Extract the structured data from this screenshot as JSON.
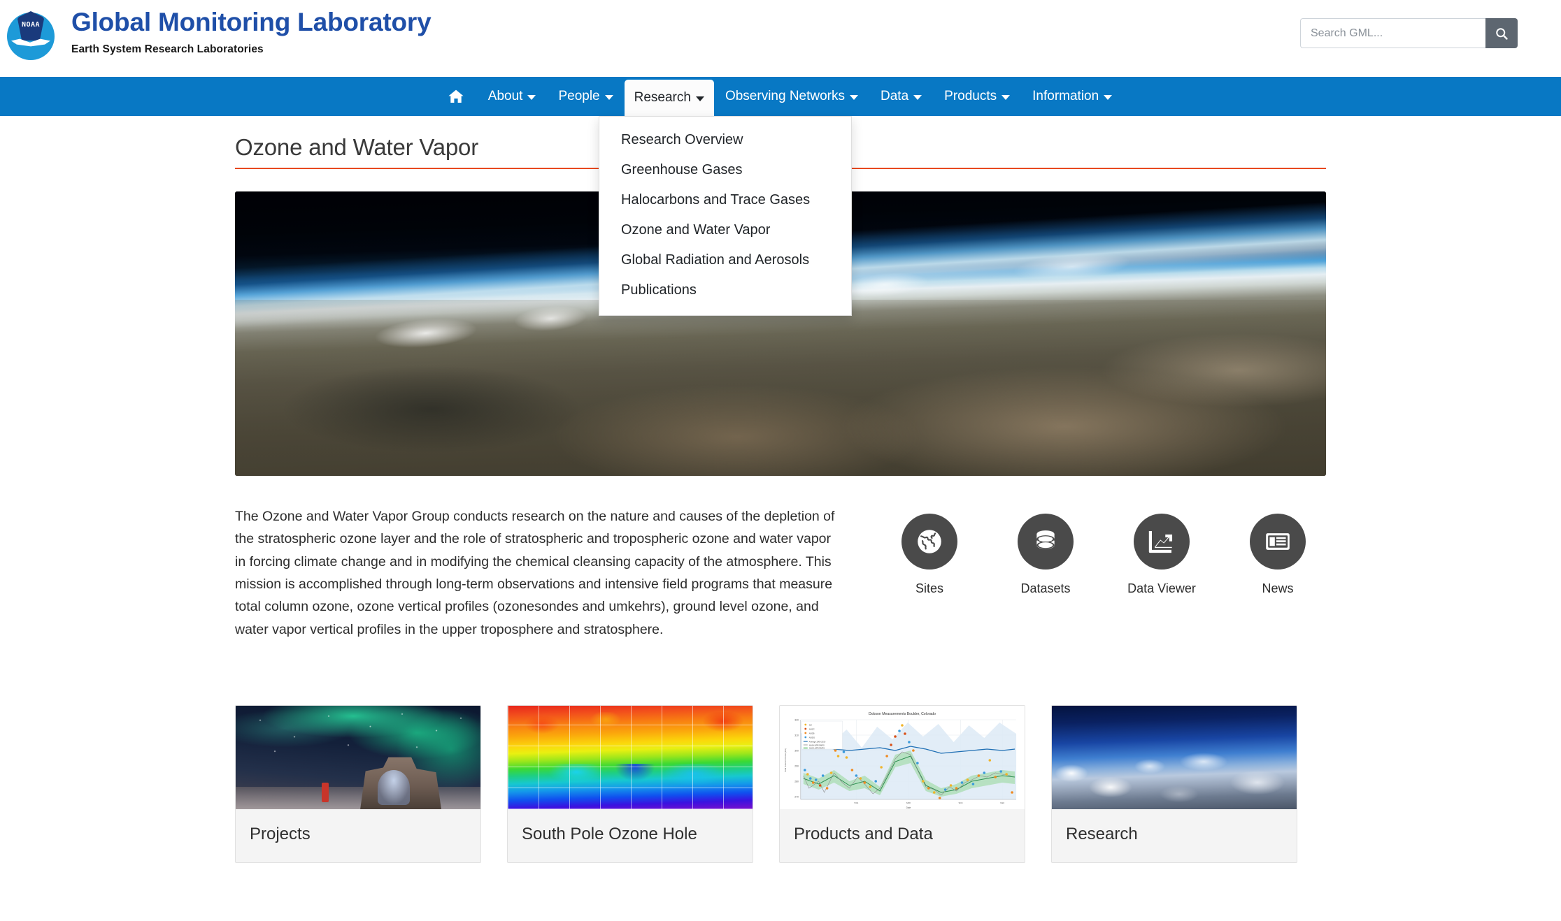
{
  "header": {
    "logo_alt": "NOAA",
    "logo_word": "NOAA",
    "title": "Global Monitoring Laboratory",
    "subtitle": "Earth System Research Laboratories"
  },
  "search": {
    "placeholder": "Search GML...",
    "value": "",
    "button_icon": "search-icon"
  },
  "nav": {
    "home_icon": "home-icon",
    "items": [
      {
        "label": "About",
        "has_caret": true,
        "active": false
      },
      {
        "label": "People",
        "has_caret": true,
        "active": false
      },
      {
        "label": "Research",
        "has_caret": true,
        "active": true
      },
      {
        "label": "Observing Networks",
        "has_caret": true,
        "active": false
      },
      {
        "label": "Data",
        "has_caret": true,
        "active": false
      },
      {
        "label": "Products",
        "has_caret": true,
        "active": false
      },
      {
        "label": "Information",
        "has_caret": true,
        "active": false
      }
    ]
  },
  "dropdown": {
    "open_for": "Research",
    "items": [
      "Research Overview",
      "Greenhouse Gases",
      "Halocarbons and Trace Gases",
      "Ozone and Water Vapor",
      "Global Radiation and Aerosols",
      "Publications"
    ]
  },
  "main": {
    "page_title": "Ozone and Water Vapor",
    "hero_alt": "Earth limb viewed from space with mountain terrain",
    "intro": "The Ozone and Water Vapor Group conducts research on the nature and causes of the depletion of the stratospheric ozone layer and the role of stratospheric and tropospheric ozone and water vapor in forcing climate change and in modifying the chemical cleansing capacity of the atmosphere. This mission is accomplished through long-term observations and intensive field programs that measure total column ozone, ozone vertical profiles (ozonesondes and umkehrs), ground level ozone, and water vapor vertical profiles in the upper troposphere and stratosphere.",
    "quick_links": [
      {
        "label": "Sites",
        "icon": "globe-icon"
      },
      {
        "label": "Datasets",
        "icon": "database-icon"
      },
      {
        "label": "Data Viewer",
        "icon": "chart-line-icon"
      },
      {
        "label": "News",
        "icon": "newspaper-icon"
      }
    ],
    "cards": [
      {
        "title": "Projects",
        "thumb": "aurora-over-polar-station"
      },
      {
        "title": "South Pole Ozone Hole",
        "thumb": "ozone-profile-heatmap"
      },
      {
        "title": "Products and Data",
        "thumb": "dobson-measurements-chart"
      },
      {
        "title": "Research",
        "thumb": "atmosphere-from-aircraft"
      }
    ]
  },
  "card_chart": {
    "type": "scatter",
    "title": "Dobson Measurements Boulder, Colorado",
    "xlabel": "Date",
    "ylabel": "Total Column Ozone (DU)",
    "ylim": [
      260,
      325
    ],
    "yticks": [
      260,
      270,
      280,
      290,
      300,
      310,
      320
    ],
    "xticks": [
      "5/01",
      "6/08",
      "9/15",
      "9/22"
    ],
    "legend": [
      {
        "label": "CZ",
        "color": "#f0b429"
      },
      {
        "label": "AD2C",
        "color": "#d94f16"
      },
      {
        "label": "AD2B",
        "color": "#ef8a22"
      },
      {
        "label": "ADDS",
        "color": "#3a9bdc"
      },
      {
        "label": "Average 1966-2019",
        "color": "#1f6fb4"
      },
      {
        "label": "NASA NPP/OMPS",
        "color": "#888888"
      },
      {
        "label": "NOAA NPP/OMPS",
        "color": "#8ed39a"
      }
    ]
  },
  "colors": {
    "nav_blue": "#0878c4",
    "brand_blue": "#1f4fa8",
    "title_rule_orange": "#e8491f",
    "icon_circle_gray": "#4a4a4a",
    "search_button_gray": "#5d6670"
  }
}
